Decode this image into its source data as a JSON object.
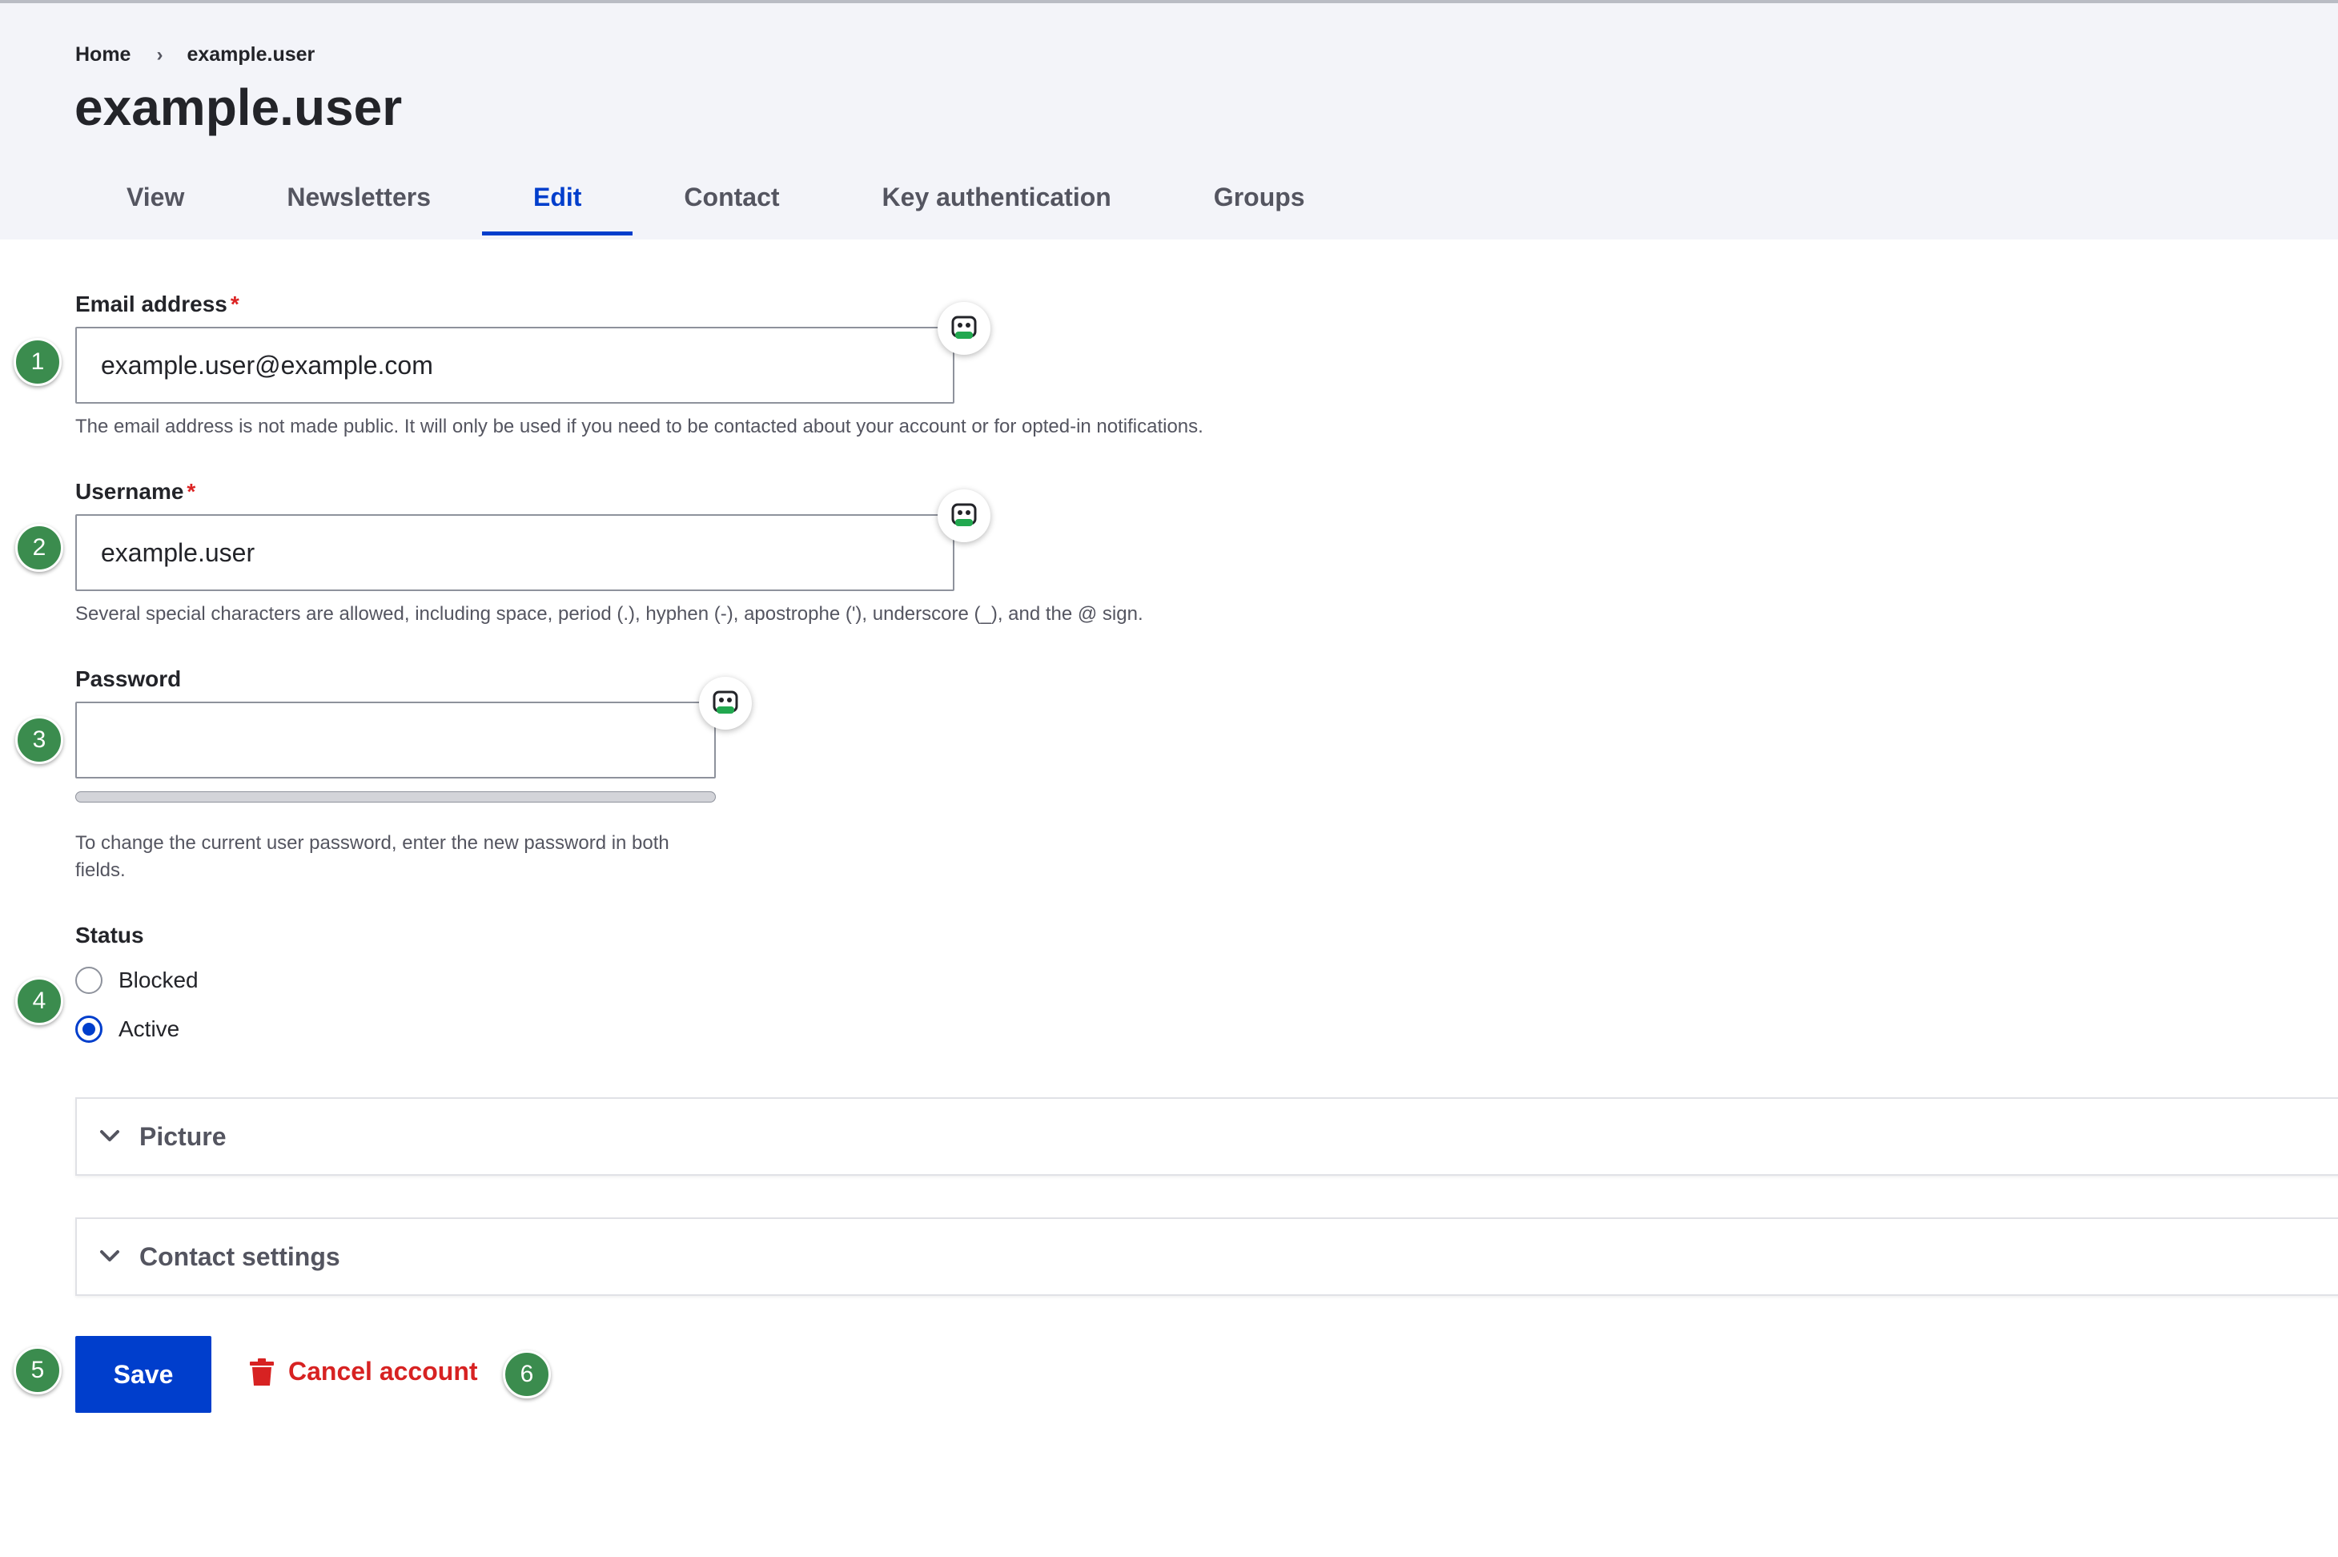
{
  "breadcrumb": {
    "home": "Home",
    "separator": "›",
    "current": "example.user"
  },
  "page_title": "example.user",
  "tabs": [
    {
      "label": "View",
      "active": false
    },
    {
      "label": "Newsletters",
      "active": false
    },
    {
      "label": "Edit",
      "active": true
    },
    {
      "label": "Contact",
      "active": false
    },
    {
      "label": "Key authentication",
      "active": false
    },
    {
      "label": "Groups",
      "active": false
    }
  ],
  "form": {
    "email": {
      "label": "Email address",
      "required_marker": "*",
      "value": "example.user@example.com",
      "description": "The email address is not made public. It will only be used if you need to be contacted about your account or for opted-in notifications."
    },
    "username": {
      "label": "Username",
      "required_marker": "*",
      "value": "example.user",
      "description": "Several special characters are allowed, including space, period (.), hyphen (-), apostrophe ('), underscore (_), and the @ sign."
    },
    "password": {
      "label": "Password",
      "value": "",
      "description": "To change the current user password, enter the new password in both fields."
    },
    "status": {
      "label": "Status",
      "options": [
        {
          "label": "Blocked",
          "checked": false
        },
        {
          "label": "Active",
          "checked": true
        }
      ]
    },
    "sections": [
      {
        "label": "Picture"
      },
      {
        "label": "Contact settings"
      }
    ],
    "save_label": "Save",
    "cancel_label": "Cancel account"
  },
  "badges": [
    "1",
    "2",
    "3",
    "4",
    "5",
    "6"
  ],
  "icons": {
    "password_manager": "password-manager-icon",
    "chevron": "chevron-down-icon",
    "trash": "trash-icon"
  },
  "colors": {
    "accent": "#003ecc",
    "danger": "#d72222",
    "badge": "#3b8c4e",
    "header_bg": "#f3f4f9"
  }
}
